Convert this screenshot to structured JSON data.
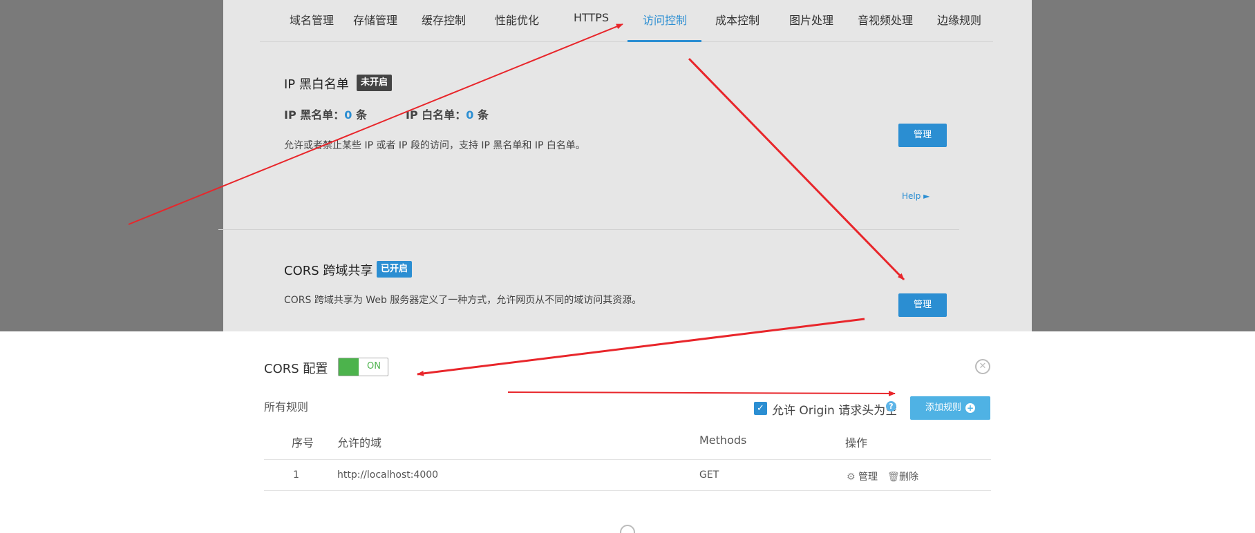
{
  "tabs": [
    {
      "label": "域名管理"
    },
    {
      "label": "存储管理"
    },
    {
      "label": "缓存控制"
    },
    {
      "label": "性能优化"
    },
    {
      "label": "HTTPS"
    },
    {
      "label": "访问控制"
    },
    {
      "label": "成本控制"
    },
    {
      "label": "图片处理"
    },
    {
      "label": "音视频处理"
    },
    {
      "label": "边缘规则"
    }
  ],
  "ip_card": {
    "title": "IP 黑白名单",
    "status": "未开启",
    "blacklist_label": "IP 黑名单：",
    "blacklist_count": "0",
    "whitelist_label": "IP 白名单：",
    "whitelist_count": "0",
    "unit": "条",
    "description": "允许或者禁止某些 IP 或者 IP 段的访问，支持 IP 黑名单和 IP 白名单。",
    "manage_label": "管理",
    "help_label": "Help ►"
  },
  "cors_card": {
    "title": "CORS 跨域共享",
    "status": "已开启",
    "description": "CORS 跨域共享为 Web 服务器定义了一种方式，允许网页从不同的域访问其资源。",
    "manage_label": "管理"
  },
  "cors_config": {
    "title": "CORS 配置",
    "toggle_label": "ON",
    "rules_label": "所有规则",
    "allow_empty_origin_label": "允许 Origin 请求头为空",
    "allow_empty_origin_checked": true,
    "add_rule_label": "添加规则"
  },
  "rules_table": {
    "headers": {
      "index": "序号",
      "domain": "允许的域",
      "methods": "Methods",
      "actions": "操作"
    },
    "rows": [
      {
        "index": "1",
        "domain": "http://localhost:4000",
        "methods": "GET",
        "manage": "管理",
        "delete": "删除"
      }
    ]
  },
  "colors": {
    "accent": "#2b8ed2",
    "toggle_on": "#4cb34c",
    "add_button": "#4fb2e4",
    "annotation_arrow": "#e8262b"
  }
}
